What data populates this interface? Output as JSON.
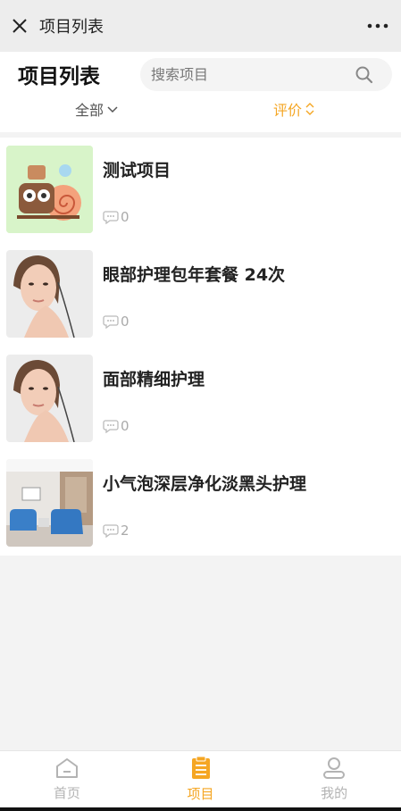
{
  "window": {
    "title": "项目列表"
  },
  "header": {
    "page_title": "项目列表",
    "search_placeholder": "搜索项目",
    "filter_all": "全部",
    "filter_rating": "评价"
  },
  "items": [
    {
      "title": "测试项目",
      "comments": "0",
      "thumb": "snail-cartoon"
    },
    {
      "title": "眼部护理包年套餐 24次",
      "comments": "0",
      "thumb": "woman-portrait"
    },
    {
      "title": "面部精细护理",
      "comments": "0",
      "thumb": "woman-portrait"
    },
    {
      "title": "小气泡深层净化淡黑头护理",
      "comments": "2",
      "thumb": "salon-room"
    }
  ],
  "tabbar": {
    "home": "首页",
    "projects": "项目",
    "mine": "我的"
  },
  "colors": {
    "accent": "#f5a623"
  },
  "icons": [
    "close-icon",
    "more-icon",
    "search-icon",
    "chevron-down-icon",
    "sort-icon",
    "comment-icon",
    "home-icon",
    "project-icon",
    "user-icon"
  ]
}
